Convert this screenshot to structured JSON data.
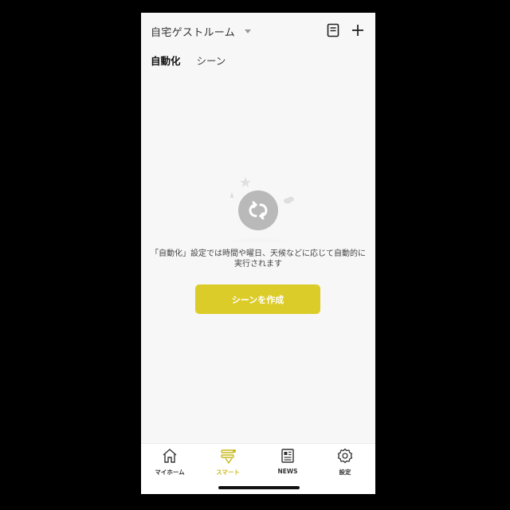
{
  "header": {
    "home_name": "自宅ゲストルーム",
    "icons": {
      "document": "document-icon",
      "add": "plus-icon"
    }
  },
  "tabs": [
    {
      "label": "自動化",
      "active": true
    },
    {
      "label": "シーン",
      "active": false
    }
  ],
  "empty_state": {
    "illustration_icon": "sync-icon",
    "line1": "「自動化」設定では時間や曜日、天候などに応じて自動的に",
    "line2": "実行されます",
    "button_label": "シーンを作成"
  },
  "bottom_nav": [
    {
      "label": "マイホーム",
      "icon": "home-icon",
      "active": false
    },
    {
      "label": "スマート",
      "icon": "smart-icon",
      "active": true
    },
    {
      "label": "NEWS",
      "icon": "news-icon",
      "active": false
    },
    {
      "label": "設定",
      "icon": "gear-icon",
      "active": false
    }
  ],
  "colors": {
    "accent": "#dccc2a",
    "accent_text": "#c9b81d",
    "background": "#f7f7f7"
  }
}
